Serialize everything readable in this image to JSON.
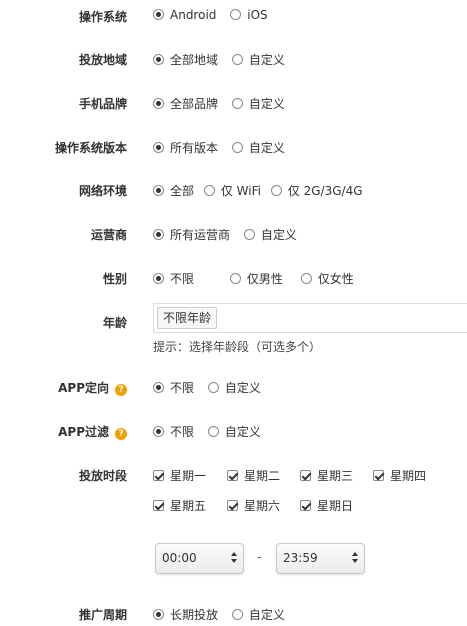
{
  "os": {
    "label": "操作系统",
    "options": [
      "Android",
      "iOS"
    ],
    "selected": 0
  },
  "region": {
    "label": "投放地域",
    "options": [
      "全部地域",
      "自定义"
    ],
    "selected": 0
  },
  "brand": {
    "label": "手机品牌",
    "options": [
      "全部品牌",
      "自定义"
    ],
    "selected": 0
  },
  "os_version": {
    "label": "操作系统版本",
    "options": [
      "所有版本",
      "自定义"
    ],
    "selected": 0
  },
  "network": {
    "label": "网络环境",
    "options": [
      "全部",
      "仅 WiFi",
      "仅 2G/3G/4G"
    ],
    "selected": 0
  },
  "carrier": {
    "label": "运营商",
    "options": [
      "所有运营商",
      "自定义"
    ],
    "selected": 0
  },
  "gender": {
    "label": "性别",
    "options": [
      "不限",
      "仅男性",
      "仅女性"
    ],
    "selected": 0
  },
  "age": {
    "label": "年龄",
    "tag": "不限年龄",
    "hint": "提示：选择年龄段（可选多个）"
  },
  "app_target": {
    "label": "APP定向",
    "help": "?",
    "options": [
      "不限",
      "自定义"
    ],
    "selected": 0
  },
  "app_filter": {
    "label": "APP过滤",
    "help": "?",
    "options": [
      "不限",
      "自定义"
    ],
    "selected": 0
  },
  "schedule": {
    "label": "投放时段",
    "days": [
      "星期一",
      "星期二",
      "星期三",
      "星期四",
      "星期五",
      "星期六",
      "星期日"
    ],
    "start": "00:00",
    "separator": "-",
    "end": "23:59"
  },
  "period": {
    "label": "推广周期",
    "options": [
      "长期投放",
      "自定义"
    ],
    "selected": 0
  }
}
